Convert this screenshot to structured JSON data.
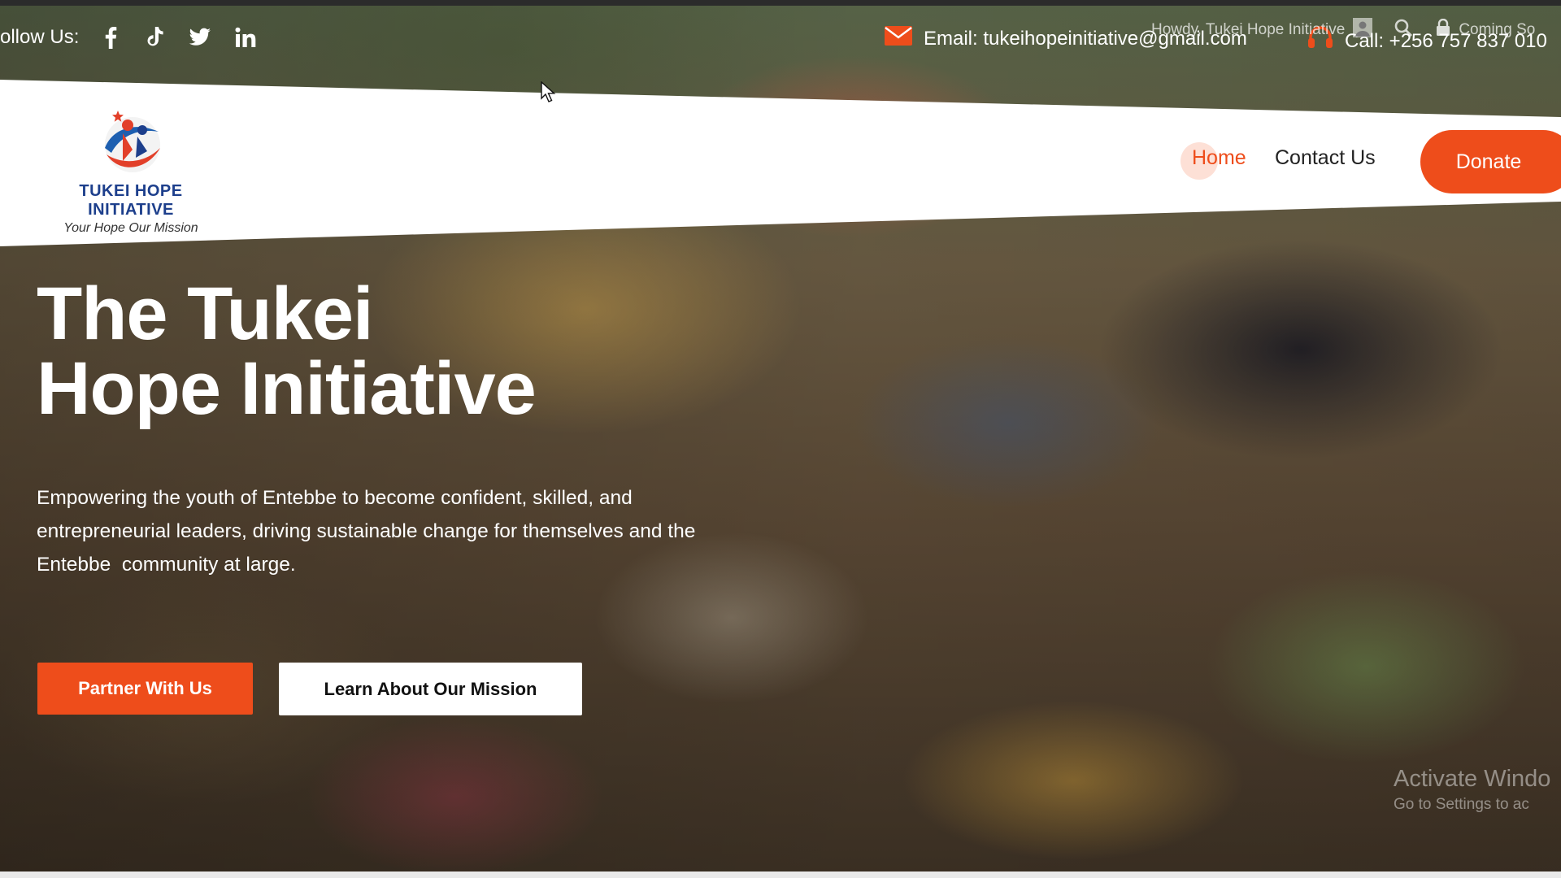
{
  "topbar": {
    "follow_label": "ollow Us:",
    "social_icons": [
      "facebook-icon",
      "tiktok-icon",
      "twitter-icon",
      "linkedin-icon"
    ],
    "email_text": "Email: tukeihopeinitiative@gmail.com",
    "call_text": "Call: +256 757 837 010"
  },
  "wp_admin": {
    "greeting": "Howdy, Tukei Hope Initiative",
    "coming_soon": "Coming So"
  },
  "header": {
    "logo_title": "TUKEI HOPE INITIATIVE",
    "logo_tagline": "Your Hope Our Mission",
    "nav": {
      "home": "Home",
      "contact": "Contact Us"
    },
    "donate_label": "Donate"
  },
  "hero": {
    "title_line1": "The Tukei",
    "title_line2": "Hope Initiative",
    "description_line1": "Empowering the youth of Entebbe to become confident, skilled, and",
    "description_line2": "entrepreneurial leaders, driving sustainable change for themselves and the",
    "description_line3": "Entebbe  community at large.",
    "partner_label": "Partner With Us",
    "mission_label": "Learn About Our Mission"
  },
  "watermark": {
    "line1": "Activate Windo",
    "line2": "Go to Settings to ac"
  },
  "colors": {
    "accent": "#ee4d1b",
    "logo_blue": "#1d3f8c",
    "text_dark": "#222222"
  }
}
